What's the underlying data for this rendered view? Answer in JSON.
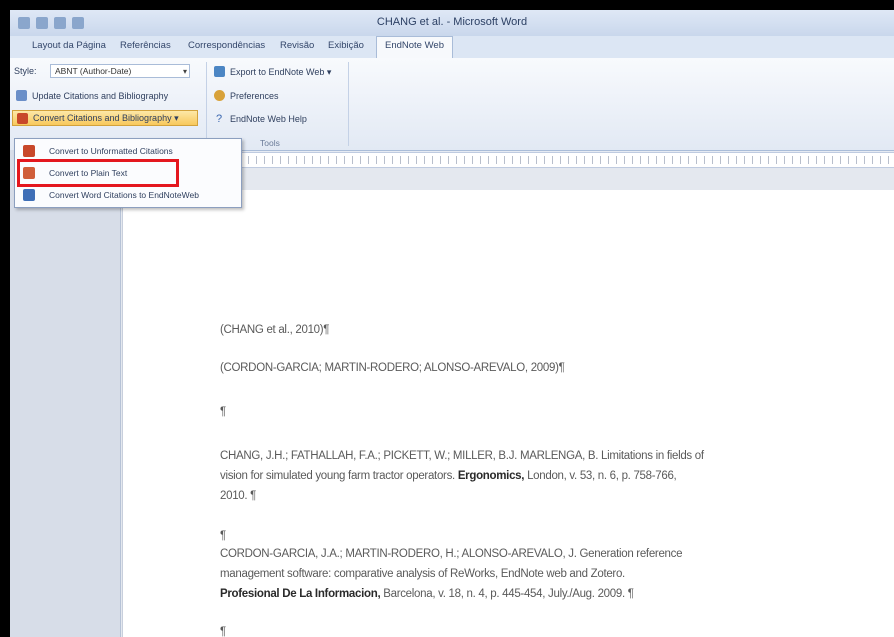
{
  "window": {
    "title": "CHANG et al. - Microsoft Word"
  },
  "tabs": [
    {
      "label": "Layout da Página"
    },
    {
      "label": "Referências"
    },
    {
      "label": "Correspondências"
    },
    {
      "label": "Revisão"
    },
    {
      "label": "Exibição"
    },
    {
      "label": "EndNote Web"
    }
  ],
  "ribbon": {
    "style_label": "Style:",
    "style_value": "ABNT (Author-Date)",
    "update_label": "Update Citations and Bibliography",
    "convert_label": "Convert Citations and Bibliography ▾",
    "export_label": "Export to EndNote Web ▾",
    "preferences_label": "Preferences",
    "help_label": "EndNote Web Help",
    "tools_label": "Tools"
  },
  "menu": {
    "items": [
      {
        "label": "Convert to Unformatted Citations"
      },
      {
        "label": "Convert to Plain Text"
      },
      {
        "label": "Convert Word Citations to EndNoteWeb"
      }
    ]
  },
  "document": {
    "p1": "(CHANG et al., 2010)¶",
    "p2": "(CORDON-GARCIA; MARTIN-RODERO; ALONSO-AREVALO, 2009)¶",
    "p3": "¶",
    "ref1_line1": "CHANG, J.H.; FATHALLAH, F.A.; PICKETT, W.; MILLER, B.J. MARLENGA, B. Limitations in fields of",
    "ref1_line2_pre": "vision for simulated young farm tractor operators. ",
    "ref1_journal": "Ergonomics,",
    "ref1_line2_post": " London, v. 53, n. 6, p. 758-766,",
    "ref1_line3": "2010. ¶",
    "p4": "¶",
    "ref2_line1": "CORDON-GARCIA, J.A.; MARTIN-RODERO, H.; ALONSO-AREVALO, J. Generation reference",
    "ref2_line2": "management software: comparative analysis of ReWorks, EndNote web and Zotero.",
    "ref2_journal": "Profesional De La Informacion,",
    "ref2_line3_post": " Barcelona, v. 18, n. 4, p. 445-454, July./Aug. 2009. ¶",
    "p5": "¶"
  },
  "colors": {
    "highlight": "#e4171e",
    "convert_button": "#f8c85c"
  }
}
